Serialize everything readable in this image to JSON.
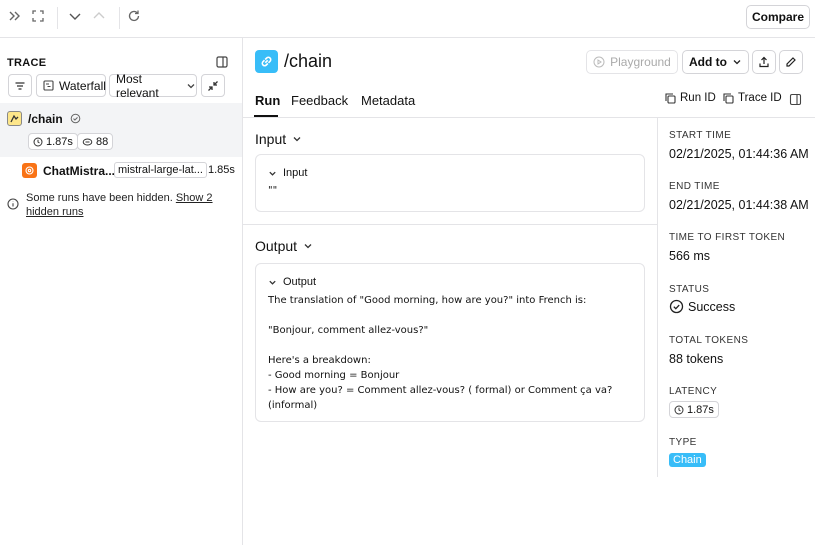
{
  "toolbar": {
    "compare_label": "Compare"
  },
  "trace": {
    "title": "TRACE",
    "waterfall_label": "Waterfall",
    "relevance_label": "Most relevant",
    "root": {
      "name": "/chain",
      "latency": "1.87s",
      "tokens": "88"
    },
    "child": {
      "name": "ChatMistra...",
      "model": "mistral-large-lat...",
      "latency": "1.85s"
    },
    "hidden_note": "Some runs have been hidden.",
    "hidden_link": "Show 2 hidden runs"
  },
  "header": {
    "title": "/chain",
    "playground_label": "Playground",
    "add_to_label": "Add to",
    "run_id_label": "Run ID",
    "trace_id_label": "Trace ID"
  },
  "tabs": [
    "Run",
    "Feedback",
    "Metadata"
  ],
  "input_section": {
    "title": "Input",
    "card_title": "Input",
    "value": "\"\""
  },
  "output_section": {
    "title": "Output",
    "card_title": "Output",
    "text": "The translation of \"Good morning, how are you?\" into French is:\n\n\"Bonjour, comment allez-vous?\"\n\nHere's a breakdown:\n- Good morning = Bonjour\n- How are you? = Comment allez-vous? ( formal) or Comment ça va?\n(informal)"
  },
  "details": {
    "start_time_label": "START TIME",
    "start_time": "02/21/2025, 01:44:36 AM",
    "end_time_label": "END TIME",
    "end_time": "02/21/2025, 01:44:38 AM",
    "ttft_label": "TIME TO FIRST TOKEN",
    "ttft": "566 ms",
    "status_label": "STATUS",
    "status": "Success",
    "tokens_label": "TOTAL TOKENS",
    "tokens": "88 tokens",
    "latency_label": "LATENCY",
    "latency": "1.87s",
    "type_label": "TYPE",
    "type": "Chain"
  },
  "colors": {
    "accent": "#38bdf8",
    "chat_icon": "#f97316",
    "selected_row": "#f3f4f6"
  }
}
